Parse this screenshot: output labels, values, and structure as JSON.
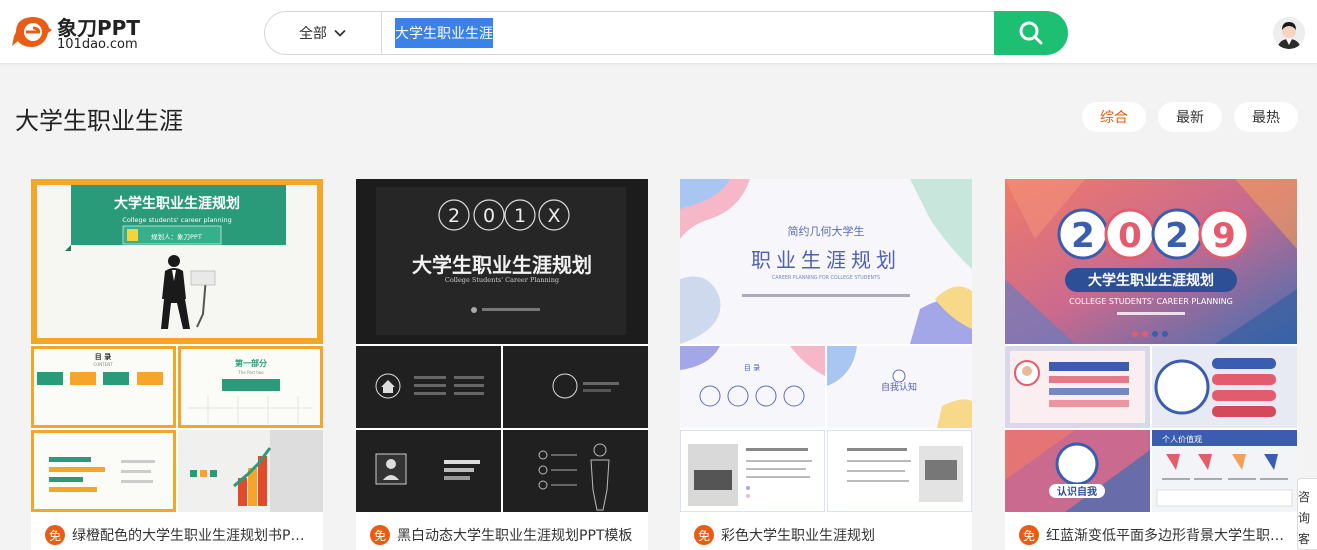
{
  "header": {
    "logo_name": "象刀PPT",
    "logo_url": "101dao.com",
    "search": {
      "scope_label": "全部",
      "query": "大学生职业生涯"
    }
  },
  "page": {
    "title": "大学生职业生涯",
    "sort_options": [
      "综合",
      "最新",
      "最热"
    ],
    "active_sort": "综合"
  },
  "colors": {
    "accent": "#e95c16",
    "search_button": "#1dbf73",
    "selection": "#3b82e8"
  },
  "results": [
    {
      "title": "绿橙配色的大学生职业生涯规划书PPT模板",
      "badge": "免",
      "cover_title": "大学生职业生涯规划",
      "cover_subtitle": "College students' career planning",
      "cover_author": "规划人：象刀PPT",
      "slide_labels": [
        "目 录",
        "CONTENT",
        "第一部分",
        "The Part two"
      ]
    },
    {
      "title": "黑白动态大学生职业生涯规划PPT模板",
      "badge": "免",
      "cover_year_digits": [
        "2",
        "0",
        "1",
        "X"
      ],
      "cover_title": "大学生职业生涯规划",
      "cover_subtitle": "College Students' Career Planning"
    },
    {
      "title": "彩色大学生职业生涯规划",
      "badge": "免",
      "cover_kicker": "简约几何大学生",
      "cover_title": "职业生涯规划",
      "cover_subtitle": "CAREER PLANNING FOR COLLEGE STUDENTS",
      "slide_labels": [
        "目 录",
        "自我认知"
      ]
    },
    {
      "title": "红蓝渐变低平面多边形背景大学生职业生涯规划PPT模板",
      "badge": "免",
      "cover_year_digits": [
        "2",
        "0",
        "2",
        "9"
      ],
      "cover_title": "大学生职业生涯规划",
      "cover_subtitle": "COLLEGE STUDENTS' CAREER PLANNING",
      "slide_labels": [
        "认识自我",
        "个人价值观"
      ]
    }
  ],
  "floating_service": "咨询客服"
}
